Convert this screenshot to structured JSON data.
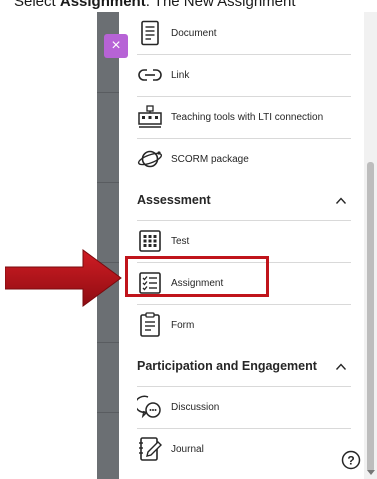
{
  "caption": {
    "lead": "Select ",
    "bold": "Assignment",
    "rest": ". The New Assignment"
  },
  "menu": {
    "items_top": [
      {
        "label": "Document",
        "icon": "document-icon"
      },
      {
        "label": "Link",
        "icon": "link-icon"
      },
      {
        "label": "Teaching tools with LTI connection",
        "icon": "teaching-tools-icon"
      },
      {
        "label": "SCORM package",
        "icon": "scorm-package-icon"
      }
    ],
    "assessment": {
      "title": "Assessment",
      "items": [
        {
          "label": "Test",
          "icon": "test-icon"
        },
        {
          "label": "Assignment",
          "icon": "assignment-icon"
        },
        {
          "label": "Form",
          "icon": "form-icon"
        }
      ]
    },
    "participation": {
      "title": "Participation and Engagement",
      "items": [
        {
          "label": "Discussion",
          "icon": "discussion-icon"
        },
        {
          "label": "Journal",
          "icon": "journal-icon"
        }
      ]
    }
  },
  "close_label": "×",
  "help_label": "?",
  "colors": {
    "accent": "#b763d6",
    "highlight": "#c0141b"
  }
}
